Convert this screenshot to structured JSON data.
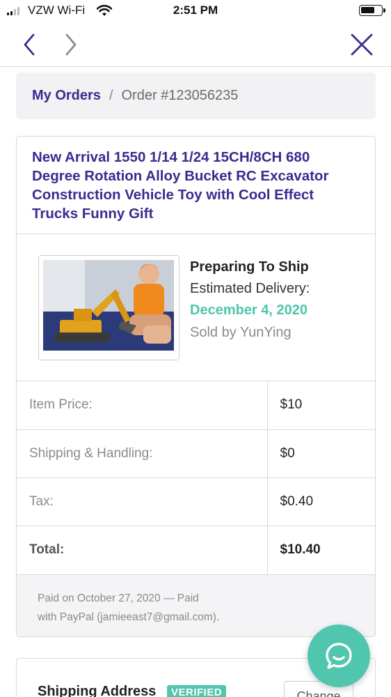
{
  "status_bar": {
    "carrier": "VZW Wi-Fi",
    "time": "2:51 PM"
  },
  "nav": {
    "back_icon": "chevron-left-icon",
    "forward_icon": "chevron-right-icon",
    "close_icon": "close-icon",
    "accent_color": "#3c2a8f"
  },
  "breadcrumb": {
    "parent": "My Orders",
    "separator": "/",
    "current": "Order #123056235"
  },
  "order": {
    "product_title": "New Arrival 1550 1/14 1/24 15CH/8CH 680 Degree Rotation Alloy Bucket RC Excavator Construction Vehicle Toy with Cool Effect Trucks Funny Gift",
    "shipping_status": "Preparing To Ship",
    "estimated_label": "Estimated Delivery:",
    "estimated_date": "December 4, 2020",
    "sold_by": "Sold by YunYing",
    "prices": [
      {
        "label": "Item Price:",
        "value": "$10"
      },
      {
        "label": "Shipping & Handling:",
        "value": "$0"
      },
      {
        "label": "Tax:",
        "value": "$0.40"
      },
      {
        "label": "Total:",
        "value": "$10.40"
      }
    ],
    "paid_line1": "Paid on October 27, 2020 — Paid",
    "paid_line2": "with PayPal (jamieeast7@gmail.com)."
  },
  "shipping": {
    "title": "Shipping Address",
    "badge": "VERIFIED",
    "change_label": "Change"
  },
  "chat": {
    "icon": "chat-bubble-icon",
    "color": "#4fc6ad"
  }
}
